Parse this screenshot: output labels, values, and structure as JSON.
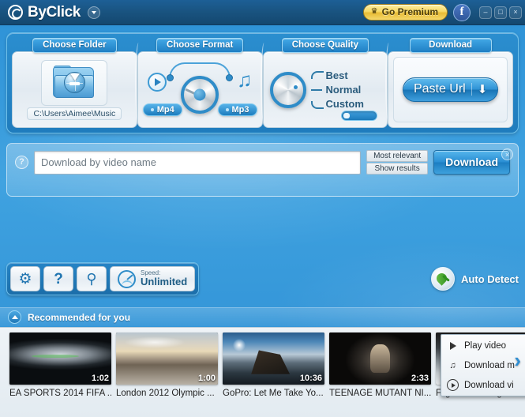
{
  "titlebar": {
    "app_name": "ByClick",
    "logo_icon": "byclick-logo-icon",
    "dropdown_icon": "chevron-down-icon",
    "premium_label": "Go Premium",
    "premium_icon": "crown-icon",
    "premium_color": "#f2d25c",
    "facebook_label": "f",
    "minimize_label": "–",
    "maximize_label": "□",
    "close_label": "×"
  },
  "modules": {
    "folder": {
      "tab_label": "Choose Folder",
      "icon": "download-folder-icon",
      "path_value": "C:\\Users\\Aimee\\Music"
    },
    "format": {
      "tab_label": "Choose Format",
      "video_label": "Mp4",
      "audio_label": "Mp3",
      "play_icon": "play-circle-icon",
      "music_icon": "music-note-icon",
      "music_glyph": "♫",
      "selected": "Mp4"
    },
    "quality": {
      "tab_label": "Choose Quality",
      "options": [
        "Best",
        "Normal",
        "Custom"
      ],
      "selected": "Best",
      "custom_toggle_state": "off"
    },
    "download": {
      "tab_label": "Download",
      "paste_label": "Paste Url",
      "paste_icon": "download-arrow-icon",
      "arrow_glyph": "⬇"
    }
  },
  "search": {
    "help_icon": "help-icon",
    "help_glyph": "?",
    "placeholder": "Download by video name",
    "value": "",
    "relevance_top": "Most relevant",
    "relevance_bottom": "Show results",
    "download_label": "Download",
    "close_icon": "close-icon",
    "close_glyph": "×"
  },
  "toolbar": {
    "settings_icon": "gear-icon",
    "settings_glyph": "⚙",
    "help_icon": "question-icon",
    "help_glyph": "?",
    "search_icon": "magnifier-icon",
    "search_glyph": "⚲",
    "speed_icon": "speedometer-icon",
    "speed_key": "Speed:",
    "speed_value": "Unlimited",
    "auto_detect_label": "Auto Detect",
    "auto_detect_icon": "satellite-dish-icon"
  },
  "recommended": {
    "header_label": "Recommended for you",
    "collapse_icon": "chevron-up-icon",
    "next_icon": "chevron-right-icon",
    "next_glyph": "›",
    "items": [
      {
        "title": "EA SPORTS 2014 FIFA ...",
        "duration": "1:02",
        "art": "art-fifa"
      },
      {
        "title": "London 2012 Olympic ...",
        "duration": "1:00",
        "art": "art-london"
      },
      {
        "title": "GoPro: Let Me Take Yo...",
        "duration": "10:36",
        "art": "art-gopro"
      },
      {
        "title": "TEENAGE MUTANT NI...",
        "duration": "2:33",
        "art": "art-tmnt"
      },
      {
        "title": "Flight at the Edge o",
        "duration": "",
        "art": "art-flight"
      }
    ],
    "context_menu": {
      "play_video": "Play video",
      "download_music": "Download m",
      "download_video": "Download vi",
      "play_icon": "play-icon",
      "music_icon": "music-note-icon",
      "music_glyph": "♫",
      "video_icon": "play-circle-icon"
    }
  }
}
